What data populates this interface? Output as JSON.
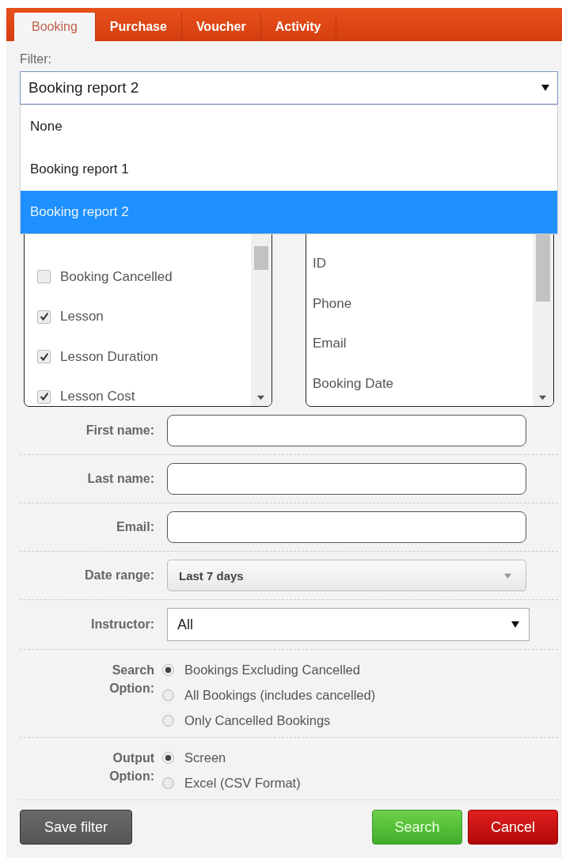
{
  "tabs": [
    {
      "label": "Booking",
      "selected": true
    },
    {
      "label": "Purchase",
      "selected": false
    },
    {
      "label": "Voucher",
      "selected": false
    },
    {
      "label": "Activity",
      "selected": false
    }
  ],
  "filter": {
    "label": "Filter:",
    "value": "Booking report 2",
    "expanded": true,
    "options": [
      {
        "label": "None",
        "selected": false
      },
      {
        "label": "Booking report 1",
        "selected": false
      },
      {
        "label": "Booking report 2",
        "selected": true
      }
    ]
  },
  "column_list": {
    "items": [
      {
        "label": "Booking Cancelled",
        "checked": false
      },
      {
        "label": "Lesson",
        "checked": true
      },
      {
        "label": "Lesson Duration",
        "checked": true
      },
      {
        "label": "Lesson Cost",
        "checked": true
      }
    ]
  },
  "field_list": {
    "items": [
      "ID",
      "Phone",
      "Email",
      "Booking Date"
    ]
  },
  "form": {
    "fields": [
      {
        "kind": "text",
        "label": "First name:"
      },
      {
        "kind": "text",
        "label": "Last name:"
      },
      {
        "kind": "text",
        "label": "Email:"
      },
      {
        "kind": "dropdown",
        "label": "Date range:",
        "value": "Last 7 days"
      },
      {
        "kind": "select",
        "label": "Instructor:",
        "value": "All"
      }
    ],
    "option_groups": [
      {
        "label": "Search Option:",
        "options": [
          {
            "label": "Bookings Excluding Cancelled",
            "selected": true
          },
          {
            "label": "All Bookings (includes cancelled)",
            "selected": false
          },
          {
            "label": "Only Cancelled Bookings",
            "selected": false
          }
        ]
      },
      {
        "label": "Output Option:",
        "options": [
          {
            "label": "Screen",
            "selected": true
          },
          {
            "label": "Excel (CSV Format)",
            "selected": false
          }
        ]
      }
    ]
  },
  "buttons": {
    "save": "Save filter",
    "search": "Search",
    "cancel": "Cancel"
  }
}
